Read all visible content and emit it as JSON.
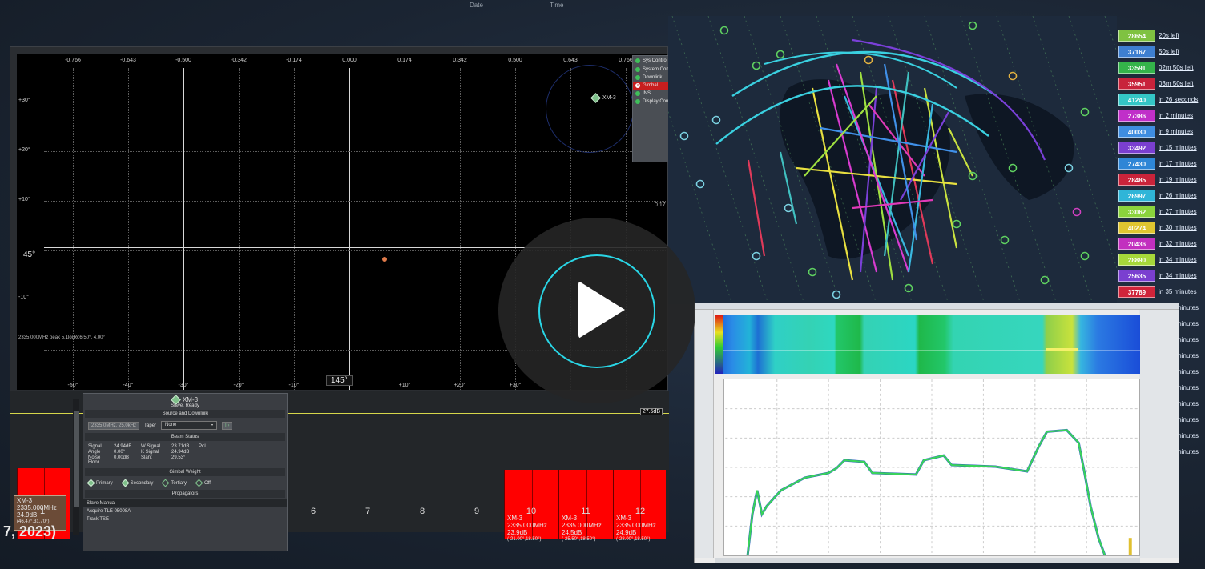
{
  "top_fragments": [
    "Date",
    "Time"
  ],
  "date_fragment": "7, 2023)",
  "polar": {
    "top_ticks": [
      "-0.766",
      "-0.643",
      "-0.500",
      "-0.342",
      "-0.174",
      "0.000",
      "0.174",
      "0.342",
      "0.500",
      "0.643",
      "0.766"
    ],
    "left_ticks": [
      "+30°",
      "+20°",
      "+10°",
      "-10°"
    ],
    "bottom_ticks": [
      "-50°",
      "-40°",
      "-30°",
      "-20°",
      "-10°",
      "+10°",
      "+20°",
      "+30°"
    ],
    "boresight": "45°",
    "center_angle": "145°",
    "right_tick": "0.17",
    "peak_readout": "2335.000MHz peak 5.1lo(Ro6.50°, 4.00°",
    "target_label": "XM-3"
  },
  "sys_control": {
    "title": "Sys Control",
    "items": [
      {
        "label": "System Control",
        "status": "ok"
      },
      {
        "label": "Downlink",
        "status": "ok"
      },
      {
        "label": "Gimbal",
        "status": "error"
      },
      {
        "label": "INS",
        "status": "ok"
      },
      {
        "label": "Display Control",
        "status": "ok"
      }
    ]
  },
  "beams": {
    "level_tag": "27.5dB",
    "numbers": [
      "1",
      "6",
      "7",
      "8",
      "9",
      "10",
      "11",
      "12"
    ],
    "beam1": {
      "name": "XM-3",
      "freq": "2335.000MHz",
      "snr": "24.9dB",
      "pos": "(46.47°,31.70°)"
    },
    "right": [
      {
        "name": "XM-3",
        "freq": "2335.000MHz",
        "snr": "23.9dB",
        "pos": "(-21.00°,18.50°)"
      },
      {
        "name": "XM-3",
        "freq": "2335.000MHz",
        "snr": "24.5dB",
        "pos": "(-25.50°,18.50°)"
      },
      {
        "name": "XM-3",
        "freq": "2335.000MHz",
        "snr": "24.9dB",
        "pos": "(-28.00°,18.50°)"
      }
    ]
  },
  "sat_panel": {
    "title": "XM-3",
    "state": "Slave, Ready",
    "source_header": "Source and Downlink",
    "source_value": "2335.0MHz, 25.0kHz",
    "taper_label": "Taper",
    "taper_value": "None",
    "beam_status_header": "Beam Status",
    "beam_status": [
      [
        "Signal",
        "24.94dB",
        "W Signal",
        "23.71dB",
        "Pol"
      ],
      [
        "Angle",
        "0.00°",
        "K Signal",
        "24.94dB",
        ""
      ],
      [
        "Noise Floor",
        "0.00dB",
        "Slant",
        "29.53°",
        ""
      ]
    ],
    "gimbal_header": "Gimbal Weight",
    "weights": [
      "Primary",
      "Secondary",
      "Tertiary",
      "Off"
    ],
    "prop_header": "Propagators",
    "propagators": [
      "Slave Manual",
      "Acquire TLE 05008A",
      "Track TSE"
    ]
  },
  "passes": [
    {
      "id": "28654",
      "eta": "20s left",
      "color": "#7fc241"
    },
    {
      "id": "37167",
      "eta": "50s left",
      "color": "#3e7fd0"
    },
    {
      "id": "33591",
      "eta": "02m 50s left",
      "color": "#34b34a"
    },
    {
      "id": "35951",
      "eta": "03m 50s left",
      "color": "#c8233b"
    },
    {
      "id": "41240",
      "eta": "in 26 seconds",
      "color": "#34c6c6"
    },
    {
      "id": "27386",
      "eta": "in 2 minutes",
      "color": "#c02fc9"
    },
    {
      "id": "40030",
      "eta": "in 9 minutes",
      "color": "#3f8de0"
    },
    {
      "id": "33492",
      "eta": "in 15 minutes",
      "color": "#7a3fd0"
    },
    {
      "id": "27430",
      "eta": "in 17 minutes",
      "color": "#2e86d6"
    },
    {
      "id": "28485",
      "eta": "in 19 minutes",
      "color": "#c9233a"
    },
    {
      "id": "26997",
      "eta": "in 26 minutes",
      "color": "#2fb5d8"
    },
    {
      "id": "33062",
      "eta": "in 27 minutes",
      "color": "#8bd33c"
    },
    {
      "id": "40274",
      "eta": "in 30 minutes",
      "color": "#e0c530"
    },
    {
      "id": "20436",
      "eta": "in 32 minutes",
      "color": "#c22fbf"
    },
    {
      "id": "28890",
      "eta": "in 34 minutes",
      "color": "#a6d83a"
    },
    {
      "id": "25635",
      "eta": "in 34 minutes",
      "color": "#7a3fd0"
    },
    {
      "id": "37789",
      "eta": "in 35 minutes",
      "color": "#d0243a"
    }
  ],
  "pass_overflow": [
    "minutes",
    "minutes",
    "minutes",
    "minutes",
    "minutes",
    "minutes",
    "minutes",
    "minutes",
    "minutes",
    "minutes"
  ],
  "colors": {
    "accent": "#29d6e6",
    "beam": "#ff0000",
    "console": "#2a2d31"
  }
}
